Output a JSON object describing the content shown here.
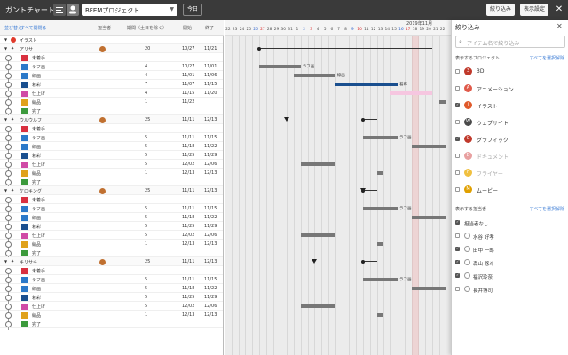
{
  "header": {
    "title": "ガントチャート",
    "project": "BFEMプロジェクト",
    "today_label": "今日",
    "filter_label": "絞り込み",
    "view_settings_label": "表示設定",
    "close_glyph": "✕"
  },
  "columns": {
    "collapse": "並び替え",
    "expand": "すべて開閉る",
    "assignee": "担当者",
    "duration": "期間（土日を除く）",
    "start": "開始",
    "end": "終了"
  },
  "calendar": {
    "month": "2019年11月",
    "days": [
      "22",
      "23",
      "24",
      "25",
      "26",
      "27",
      "28",
      "29",
      "30",
      "31",
      "1",
      "2",
      "3",
      "4",
      "5",
      "6",
      "7",
      "8",
      "9",
      "10",
      "11",
      "12",
      "13",
      "14",
      "15",
      "16",
      "17",
      "18",
      "19",
      "20",
      "21",
      "22"
    ]
  },
  "rows": [
    {
      "kind": "cat",
      "name": "イラスト"
    },
    {
      "kind": "sec",
      "name": "アリサ",
      "days": "20",
      "start": "10/27",
      "end": "11/21"
    },
    {
      "kind": "task",
      "name": "未着手",
      "color": "#d9303f",
      "days": "",
      "start": "",
      "end": ""
    },
    {
      "kind": "task",
      "name": "ラフ画",
      "color": "#2b79c9",
      "days": "4",
      "start": "10/27",
      "end": "11/01"
    },
    {
      "kind": "task",
      "name": "線画",
      "color": "#2b79c9",
      "days": "4",
      "start": "11/01",
      "end": "11/06"
    },
    {
      "kind": "task",
      "name": "着彩",
      "color": "#1a4f8f",
      "days": "7",
      "start": "11/07",
      "end": "11/15"
    },
    {
      "kind": "task",
      "name": "仕上げ",
      "color": "#d04aa6",
      "days": "4",
      "start": "11/15",
      "end": "11/20"
    },
    {
      "kind": "task",
      "name": "納品",
      "color": "#e0a21b",
      "days": "1",
      "start": "11/22",
      "end": ""
    },
    {
      "kind": "task",
      "name": "完了",
      "color": "#3c9a3c",
      "days": "",
      "start": "",
      "end": ""
    },
    {
      "kind": "sec",
      "name": "ウルウルフ",
      "days": "25",
      "start": "11/11",
      "end": "12/13"
    },
    {
      "kind": "task",
      "name": "未着手",
      "color": "#d9303f",
      "days": "",
      "start": "",
      "end": ""
    },
    {
      "kind": "task",
      "name": "ラフ画",
      "color": "#2b79c9",
      "days": "5",
      "start": "11/11",
      "end": "11/15"
    },
    {
      "kind": "task",
      "name": "線画",
      "color": "#2b79c9",
      "days": "5",
      "start": "11/18",
      "end": "11/22"
    },
    {
      "kind": "task",
      "name": "着彩",
      "color": "#1a4f8f",
      "days": "5",
      "start": "11/25",
      "end": "11/29"
    },
    {
      "kind": "task",
      "name": "仕上げ",
      "color": "#d04aa6",
      "days": "5",
      "start": "12/02",
      "end": "12/06"
    },
    {
      "kind": "task",
      "name": "納品",
      "color": "#e0a21b",
      "days": "1",
      "start": "12/13",
      "end": "12/13"
    },
    {
      "kind": "task",
      "name": "完了",
      "color": "#3c9a3c",
      "days": "",
      "start": "",
      "end": ""
    },
    {
      "kind": "sec",
      "name": "ケロキング",
      "days": "25",
      "start": "11/11",
      "end": "12/13"
    },
    {
      "kind": "task",
      "name": "未着手",
      "color": "#d9303f",
      "days": "",
      "start": "",
      "end": ""
    },
    {
      "kind": "task",
      "name": "ラフ画",
      "color": "#2b79c9",
      "days": "5",
      "start": "11/11",
      "end": "11/15"
    },
    {
      "kind": "task",
      "name": "線画",
      "color": "#2b79c9",
      "days": "5",
      "start": "11/18",
      "end": "11/22"
    },
    {
      "kind": "task",
      "name": "着彩",
      "color": "#1a4f8f",
      "days": "5",
      "start": "11/25",
      "end": "11/29"
    },
    {
      "kind": "task",
      "name": "仕上げ",
      "color": "#d04aa6",
      "days": "5",
      "start": "12/02",
      "end": "12/06"
    },
    {
      "kind": "task",
      "name": "納品",
      "color": "#e0a21b",
      "days": "1",
      "start": "12/13",
      "end": "12/13"
    },
    {
      "kind": "task",
      "name": "完了",
      "color": "#3c9a3c",
      "days": "",
      "start": "",
      "end": ""
    },
    {
      "kind": "sec",
      "name": "キリサキ",
      "days": "25",
      "start": "11/11",
      "end": "12/13"
    },
    {
      "kind": "task",
      "name": "未着手",
      "color": "#d9303f",
      "days": "",
      "start": "",
      "end": ""
    },
    {
      "kind": "task",
      "name": "ラフ画",
      "color": "#2b79c9",
      "days": "5",
      "start": "11/11",
      "end": "11/15"
    },
    {
      "kind": "task",
      "name": "線画",
      "color": "#2b79c9",
      "days": "5",
      "start": "11/18",
      "end": "11/22"
    },
    {
      "kind": "task",
      "name": "着彩",
      "color": "#1a4f8f",
      "days": "5",
      "start": "11/25",
      "end": "11/29"
    },
    {
      "kind": "task",
      "name": "仕上げ",
      "color": "#d04aa6",
      "days": "5",
      "start": "12/02",
      "end": "12/06"
    },
    {
      "kind": "task",
      "name": "納品",
      "color": "#e0a21b",
      "days": "1",
      "start": "12/13",
      "end": "12/13"
    },
    {
      "kind": "task",
      "name": "完了",
      "color": "#3c9a3c",
      "days": "",
      "start": "",
      "end": ""
    }
  ],
  "bar_labels": {
    "rough": "ラフ画",
    "line": "線画",
    "color": "着彩"
  },
  "panel": {
    "title": "絞り込み",
    "close_glyph": "✕",
    "search_placeholder": "アイテム名で絞り込み",
    "projects_label": "表示するプロジェクト",
    "projects_link": "すべてを選択解除",
    "projects": [
      {
        "label": "3D",
        "badge": "3",
        "color": "#c0392b",
        "checked": false,
        "dim": false
      },
      {
        "label": "アニメーション",
        "badge": "A",
        "color": "#e05a4a",
        "checked": false,
        "dim": false
      },
      {
        "label": "イラスト",
        "badge": "i",
        "color": "#e05a2b",
        "checked": true,
        "dim": false
      },
      {
        "label": "ウェブサイト",
        "badge": "W",
        "color": "#4a4a4a",
        "checked": false,
        "dim": false
      },
      {
        "label": "グラフィック",
        "badge": "G",
        "color": "#c0392b",
        "checked": true,
        "dim": false
      },
      {
        "label": "ドキュメント",
        "badge": "D",
        "color": "#e8a0a0",
        "checked": false,
        "dim": true
      },
      {
        "label": "フライヤー",
        "badge": "F",
        "color": "#f0c040",
        "checked": false,
        "dim": true
      },
      {
        "label": "ムービー",
        "badge": "M",
        "color": "#e0a000",
        "checked": false,
        "dim": false
      }
    ],
    "assignees_label": "表示する担当者",
    "assignees_link": "すべてを選択解除",
    "assignees": [
      {
        "label": "担当者なし",
        "checked": true
      },
      {
        "label": "水谷 好孝",
        "checked": false
      },
      {
        "label": "田中 一郎",
        "checked": true
      },
      {
        "label": "森山 悠斗",
        "checked": true
      },
      {
        "label": "福沢玲奈",
        "checked": true
      },
      {
        "label": "長井博司",
        "checked": false
      }
    ]
  }
}
